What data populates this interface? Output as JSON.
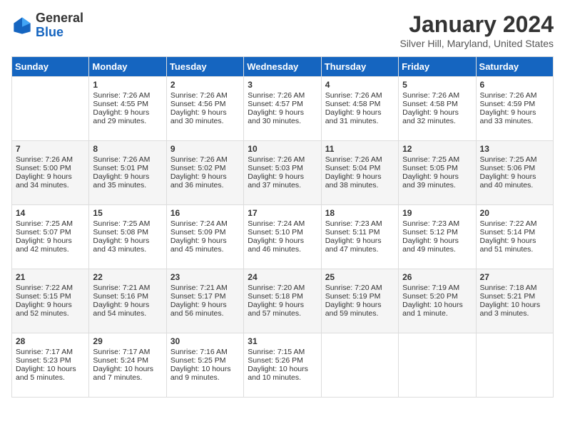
{
  "header": {
    "logo_general": "General",
    "logo_blue": "Blue",
    "month": "January 2024",
    "location": "Silver Hill, Maryland, United States"
  },
  "days_of_week": [
    "Sunday",
    "Monday",
    "Tuesday",
    "Wednesday",
    "Thursday",
    "Friday",
    "Saturday"
  ],
  "weeks": [
    [
      {
        "day": "",
        "sunrise": "",
        "sunset": "",
        "daylight": ""
      },
      {
        "day": "1",
        "sunrise": "Sunrise: 7:26 AM",
        "sunset": "Sunset: 4:55 PM",
        "daylight": "Daylight: 9 hours and 29 minutes."
      },
      {
        "day": "2",
        "sunrise": "Sunrise: 7:26 AM",
        "sunset": "Sunset: 4:56 PM",
        "daylight": "Daylight: 9 hours and 30 minutes."
      },
      {
        "day": "3",
        "sunrise": "Sunrise: 7:26 AM",
        "sunset": "Sunset: 4:57 PM",
        "daylight": "Daylight: 9 hours and 30 minutes."
      },
      {
        "day": "4",
        "sunrise": "Sunrise: 7:26 AM",
        "sunset": "Sunset: 4:58 PM",
        "daylight": "Daylight: 9 hours and 31 minutes."
      },
      {
        "day": "5",
        "sunrise": "Sunrise: 7:26 AM",
        "sunset": "Sunset: 4:58 PM",
        "daylight": "Daylight: 9 hours and 32 minutes."
      },
      {
        "day": "6",
        "sunrise": "Sunrise: 7:26 AM",
        "sunset": "Sunset: 4:59 PM",
        "daylight": "Daylight: 9 hours and 33 minutes."
      }
    ],
    [
      {
        "day": "7",
        "sunrise": "Sunrise: 7:26 AM",
        "sunset": "Sunset: 5:00 PM",
        "daylight": "Daylight: 9 hours and 34 minutes."
      },
      {
        "day": "8",
        "sunrise": "Sunrise: 7:26 AM",
        "sunset": "Sunset: 5:01 PM",
        "daylight": "Daylight: 9 hours and 35 minutes."
      },
      {
        "day": "9",
        "sunrise": "Sunrise: 7:26 AM",
        "sunset": "Sunset: 5:02 PM",
        "daylight": "Daylight: 9 hours and 36 minutes."
      },
      {
        "day": "10",
        "sunrise": "Sunrise: 7:26 AM",
        "sunset": "Sunset: 5:03 PM",
        "daylight": "Daylight: 9 hours and 37 minutes."
      },
      {
        "day": "11",
        "sunrise": "Sunrise: 7:26 AM",
        "sunset": "Sunset: 5:04 PM",
        "daylight": "Daylight: 9 hours and 38 minutes."
      },
      {
        "day": "12",
        "sunrise": "Sunrise: 7:25 AM",
        "sunset": "Sunset: 5:05 PM",
        "daylight": "Daylight: 9 hours and 39 minutes."
      },
      {
        "day": "13",
        "sunrise": "Sunrise: 7:25 AM",
        "sunset": "Sunset: 5:06 PM",
        "daylight": "Daylight: 9 hours and 40 minutes."
      }
    ],
    [
      {
        "day": "14",
        "sunrise": "Sunrise: 7:25 AM",
        "sunset": "Sunset: 5:07 PM",
        "daylight": "Daylight: 9 hours and 42 minutes."
      },
      {
        "day": "15",
        "sunrise": "Sunrise: 7:25 AM",
        "sunset": "Sunset: 5:08 PM",
        "daylight": "Daylight: 9 hours and 43 minutes."
      },
      {
        "day": "16",
        "sunrise": "Sunrise: 7:24 AM",
        "sunset": "Sunset: 5:09 PM",
        "daylight": "Daylight: 9 hours and 45 minutes."
      },
      {
        "day": "17",
        "sunrise": "Sunrise: 7:24 AM",
        "sunset": "Sunset: 5:10 PM",
        "daylight": "Daylight: 9 hours and 46 minutes."
      },
      {
        "day": "18",
        "sunrise": "Sunrise: 7:23 AM",
        "sunset": "Sunset: 5:11 PM",
        "daylight": "Daylight: 9 hours and 47 minutes."
      },
      {
        "day": "19",
        "sunrise": "Sunrise: 7:23 AM",
        "sunset": "Sunset: 5:12 PM",
        "daylight": "Daylight: 9 hours and 49 minutes."
      },
      {
        "day": "20",
        "sunrise": "Sunrise: 7:22 AM",
        "sunset": "Sunset: 5:14 PM",
        "daylight": "Daylight: 9 hours and 51 minutes."
      }
    ],
    [
      {
        "day": "21",
        "sunrise": "Sunrise: 7:22 AM",
        "sunset": "Sunset: 5:15 PM",
        "daylight": "Daylight: 9 hours and 52 minutes."
      },
      {
        "day": "22",
        "sunrise": "Sunrise: 7:21 AM",
        "sunset": "Sunset: 5:16 PM",
        "daylight": "Daylight: 9 hours and 54 minutes."
      },
      {
        "day": "23",
        "sunrise": "Sunrise: 7:21 AM",
        "sunset": "Sunset: 5:17 PM",
        "daylight": "Daylight: 9 hours and 56 minutes."
      },
      {
        "day": "24",
        "sunrise": "Sunrise: 7:20 AM",
        "sunset": "Sunset: 5:18 PM",
        "daylight": "Daylight: 9 hours and 57 minutes."
      },
      {
        "day": "25",
        "sunrise": "Sunrise: 7:20 AM",
        "sunset": "Sunset: 5:19 PM",
        "daylight": "Daylight: 9 hours and 59 minutes."
      },
      {
        "day": "26",
        "sunrise": "Sunrise: 7:19 AM",
        "sunset": "Sunset: 5:20 PM",
        "daylight": "Daylight: 10 hours and 1 minute."
      },
      {
        "day": "27",
        "sunrise": "Sunrise: 7:18 AM",
        "sunset": "Sunset: 5:21 PM",
        "daylight": "Daylight: 10 hours and 3 minutes."
      }
    ],
    [
      {
        "day": "28",
        "sunrise": "Sunrise: 7:17 AM",
        "sunset": "Sunset: 5:23 PM",
        "daylight": "Daylight: 10 hours and 5 minutes."
      },
      {
        "day": "29",
        "sunrise": "Sunrise: 7:17 AM",
        "sunset": "Sunset: 5:24 PM",
        "daylight": "Daylight: 10 hours and 7 minutes."
      },
      {
        "day": "30",
        "sunrise": "Sunrise: 7:16 AM",
        "sunset": "Sunset: 5:25 PM",
        "daylight": "Daylight: 10 hours and 9 minutes."
      },
      {
        "day": "31",
        "sunrise": "Sunrise: 7:15 AM",
        "sunset": "Sunset: 5:26 PM",
        "daylight": "Daylight: 10 hours and 10 minutes."
      },
      {
        "day": "",
        "sunrise": "",
        "sunset": "",
        "daylight": ""
      },
      {
        "day": "",
        "sunrise": "",
        "sunset": "",
        "daylight": ""
      },
      {
        "day": "",
        "sunrise": "",
        "sunset": "",
        "daylight": ""
      }
    ]
  ]
}
